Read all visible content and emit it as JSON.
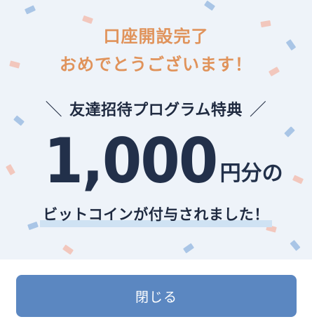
{
  "modal": {
    "title_line1": "口座開設完了",
    "title_line2": "おめでとうございます！",
    "program": {
      "open_slash": "＼",
      "text": "友達招待プログラム特典",
      "close_slash": "／"
    },
    "amount": "1,000",
    "amount_suffix": "円分の",
    "granted_text": "ビットコインが付与されました！",
    "close_button_label": "閉じる"
  },
  "colors": {
    "title_accent": "#e0935b",
    "hero_background": "#eef3f9",
    "text_dark": "#1f2a40",
    "button": "#5b87c1",
    "highlight": "#cfe2f3",
    "confetti_blue": "#a9c5e6",
    "confetti_pink": "#f2c7bd"
  }
}
